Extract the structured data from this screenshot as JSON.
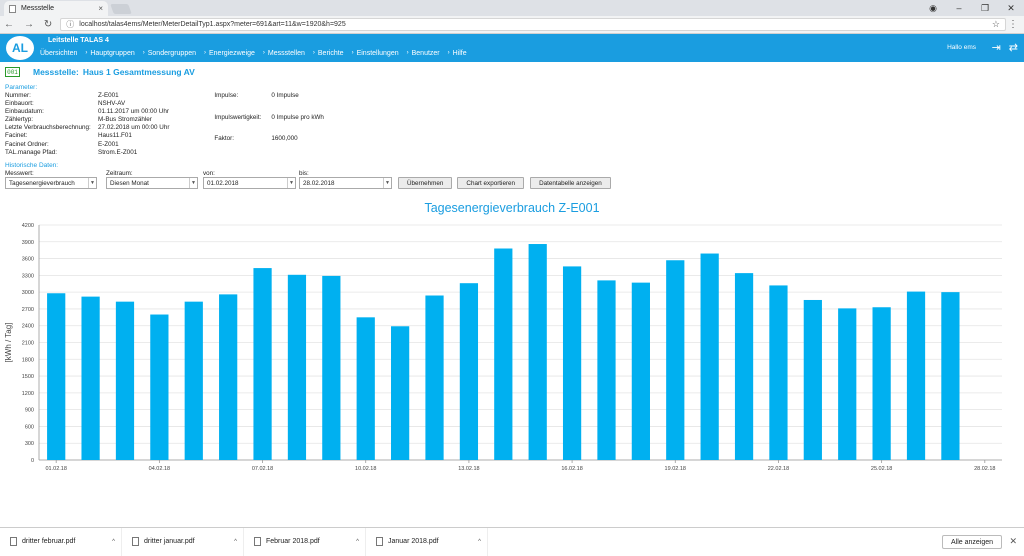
{
  "browser": {
    "tab_title": "Messstelle",
    "url": "localhost/talas4ems/Meter/MeterDetailTyp1.aspx?meter=691&art=11&w=1920&h=925"
  },
  "app": {
    "title": "Leitstelle TALAS 4",
    "logo_text": "AL",
    "greeting": "Hallo ems",
    "nav": [
      "Übersichten",
      "Hauptgruppen",
      "Sondergruppen",
      "Energiezweige",
      "Messstellen",
      "Berichte",
      "Einstellungen",
      "Benutzer",
      "Hilfe"
    ]
  },
  "meter": {
    "icon_text": "001",
    "label": "Messstelle:",
    "name": "Haus 1 Gesamtmessung AV"
  },
  "params": {
    "heading": "Parameter:",
    "left": [
      {
        "label": "Nummer:",
        "value": "Z-E001"
      },
      {
        "label": "Einbauort:",
        "value": "NSHV-AV"
      },
      {
        "label": "Einbaudatum:",
        "value": "01.11.2017 um 00:00 Uhr"
      },
      {
        "label": "Zählertyp:",
        "value": "M-Bus Stromzähler"
      },
      {
        "label": "Letzte Verbrauchsberechnung:",
        "value": "27.02.2018 um 00:00 Uhr"
      },
      {
        "label": "Facinet:",
        "value": "Haus11.F01"
      },
      {
        "label": "Facinet Ordner:",
        "value": "E-Z001"
      },
      {
        "label": "TAL.manage Pfad:",
        "value": "Strom.E-Z001"
      }
    ],
    "right": [
      {
        "label": "Impulse:",
        "value": "0 Impulse"
      },
      {
        "label": "Impulswertigkeit:",
        "value": "0 Impulse pro kWh"
      },
      {
        "label": "Faktor:",
        "value": "1600,000"
      }
    ]
  },
  "hist": {
    "heading": "Historische Daten:",
    "messwert_label": "Messwert:",
    "messwert_value": "Tagesenergieverbrauch",
    "zeitraum_label": "Zeitraum:",
    "zeitraum_value": "Diesen Monat",
    "von_label": "von:",
    "von_value": "01.02.2018",
    "bis_label": "bis:",
    "bis_value": "28.02.2018",
    "btn_apply": "Übernehmen",
    "btn_export": "Chart exportieren",
    "btn_table": "Datentabelle anzeigen"
  },
  "chart_data": {
    "type": "bar",
    "title": "Tagesenergieverbrauch Z-E001",
    "ylabel": "[kWh / Tag]",
    "ylim": [
      0,
      4200
    ],
    "yticks": [
      0,
      300,
      600,
      900,
      1200,
      1500,
      1800,
      2100,
      2400,
      2700,
      3000,
      3300,
      3600,
      3900,
      4200
    ],
    "xtick_labels": [
      "01.02.18",
      "04.02.18",
      "07.02.18",
      "10.02.18",
      "13.02.18",
      "16.02.18",
      "19.02.18",
      "22.02.18",
      "25.02.18",
      "28.02.18"
    ],
    "xtick_days": [
      1,
      4,
      7,
      10,
      13,
      16,
      19,
      22,
      25,
      28
    ],
    "categories": [
      "01.02.18",
      "02.02.18",
      "03.02.18",
      "04.02.18",
      "05.02.18",
      "06.02.18",
      "07.02.18",
      "08.02.18",
      "09.02.18",
      "10.02.18",
      "11.02.18",
      "12.02.18",
      "13.02.18",
      "14.02.18",
      "15.02.18",
      "16.02.18",
      "17.02.18",
      "18.02.18",
      "19.02.18",
      "20.02.18",
      "21.02.18",
      "22.02.18",
      "23.02.18",
      "24.02.18",
      "25.02.18",
      "26.02.18",
      "27.02.18",
      "28.02.18"
    ],
    "values": [
      2980,
      2920,
      2830,
      2600,
      2830,
      2960,
      3430,
      3310,
      3290,
      2550,
      2390,
      2940,
      3160,
      3780,
      3860,
      3460,
      3210,
      3170,
      3570,
      3690,
      3340,
      3120,
      2860,
      2710,
      2730,
      3010,
      3000,
      null
    ],
    "color": "#00b0f0",
    "grid": true
  },
  "downloads": {
    "items": [
      "dritter februar.pdf",
      "dritter januar.pdf",
      "Februar 2018.pdf",
      "Januar 2018.pdf"
    ],
    "show_all": "Alle anzeigen"
  }
}
